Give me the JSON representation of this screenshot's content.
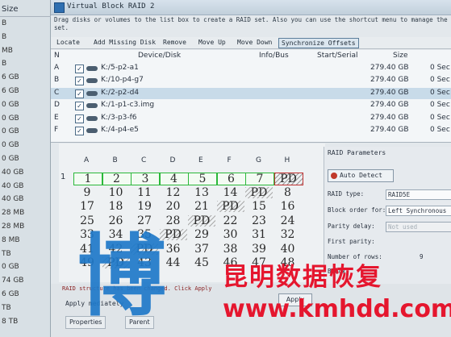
{
  "left_panel": {
    "header": "Size",
    "sizes": [
      "B",
      "B",
      "MB",
      "B",
      "6 GB",
      "6 GB",
      "0 GB",
      "0 GB",
      "0 GB",
      "0 GB",
      "0 GB",
      "40 GB",
      "40 GB",
      "40 GB",
      "28 MB",
      "28 MB",
      "8 MB",
      "TB",
      "0 GB",
      "74 GB",
      "6 GB",
      "TB",
      "8 TB"
    ]
  },
  "window": {
    "title": "Virtual Block RAID 2",
    "hint": "Drag disks or volumes to the list box to create a RAID set. Also you can use the shortcut menu to manage the set."
  },
  "toolbar": {
    "locate": "Locate",
    "add_missing": "Add Missing Disk",
    "remove": "Remove",
    "move_up": "Move Up",
    "move_down": "Move Down",
    "sync": "Synchronize Offsets"
  },
  "list": {
    "headers": {
      "n": "N",
      "device": "Device/Disk",
      "info": "Info/Bus",
      "serial": "Start/Serial",
      "size": "Size"
    },
    "rows": [
      {
        "letter": "A",
        "device": "K:/5-p2-a1",
        "size": "279.40 GB",
        "offset": "0 Sec"
      },
      {
        "letter": "B",
        "device": "K:/10-p4-g7",
        "size": "279.40 GB",
        "offset": "0 Sec"
      },
      {
        "letter": "C",
        "device": "K:/2-p2-d4",
        "size": "279.40 GB",
        "offset": "0 Sec"
      },
      {
        "letter": "D",
        "device": "K:/1-p1-c3.img",
        "size": "279.40 GB",
        "offset": "0 Sec"
      },
      {
        "letter": "E",
        "device": "K:/3-p3-f6",
        "size": "279.40 GB",
        "offset": "0 Sec"
      },
      {
        "letter": "F",
        "device": "K:/4-p4-e5",
        "size": "279.40 GB",
        "offset": "0 Sec"
      }
    ]
  },
  "grid": {
    "columns": [
      "A",
      "B",
      "C",
      "D",
      "E",
      "F",
      "G",
      "H"
    ],
    "row_labels": [
      "1"
    ],
    "rows": [
      [
        "1",
        "2",
        "3",
        "4",
        "5",
        "6",
        "7",
        "PD"
      ],
      [
        "9",
        "10",
        "11",
        "12",
        "13",
        "14",
        "PD",
        "8"
      ],
      [
        "17",
        "18",
        "19",
        "20",
        "21",
        "PD",
        "15",
        "16"
      ],
      [
        "25",
        "26",
        "27",
        "28",
        "PD",
        "22",
        "23",
        "24"
      ],
      [
        "33",
        "34",
        "35",
        "PD",
        "29",
        "30",
        "31",
        "32"
      ],
      [
        "41",
        "42",
        "PD",
        "36",
        "37",
        "38",
        "39",
        "40"
      ],
      [
        "49",
        "PD",
        "43",
        "44",
        "45",
        "46",
        "47",
        "48"
      ]
    ]
  },
  "params": {
    "title": "RAID Parameters",
    "auto_detect": "Auto Detect",
    "raid_type_label": "RAID type:",
    "raid_type": "RAID5E",
    "block_order_label": "Block order for:",
    "block_order": "Left Synchronous",
    "parity_delay_label": "Parity delay:",
    "parity_delay": "Not used",
    "first_parity_label": "First parity:",
    "rows_label": "Number of rows:",
    "rows_value": "9",
    "block_label": "Block"
  },
  "bottom": {
    "red_text": "RAID structure has been changed. Click Apply",
    "app_check": "Apply",
    "app_check_suffix": "mediately",
    "apply": "Apply",
    "tab_properties": "Properties",
    "tab_parent": "Parent"
  },
  "watermark": {
    "glyph": "博",
    "brand": "昆明数据恢复",
    "url": "www.kmhdd.com"
  }
}
